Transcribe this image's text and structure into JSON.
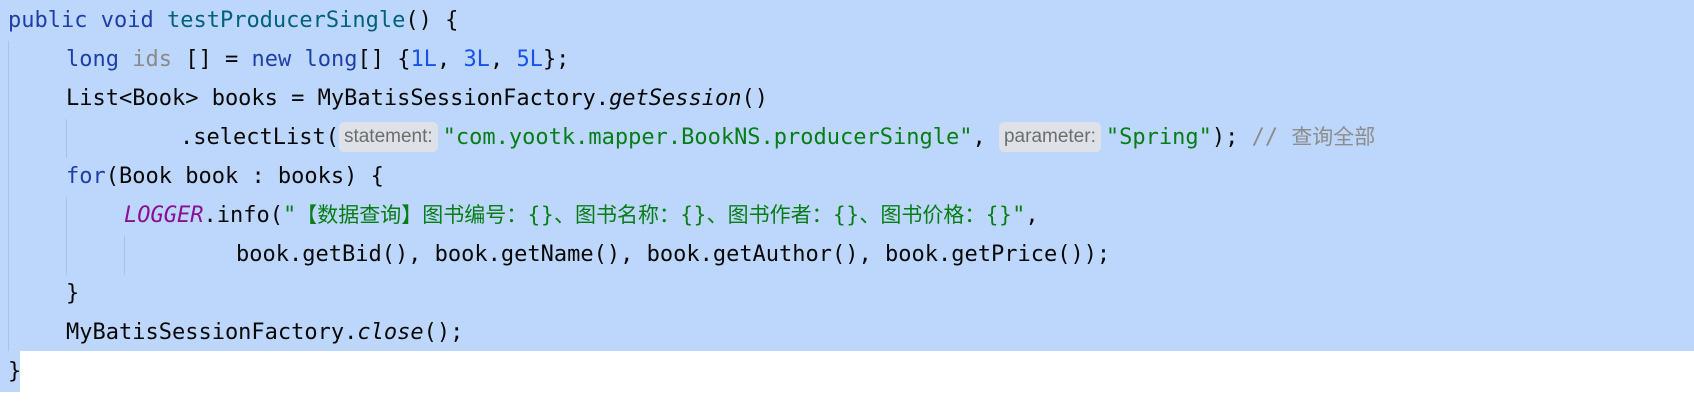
{
  "code": {
    "line1": {
      "kw1": "public",
      "kw2": "void",
      "method": "testProducerSingle",
      "rest": "() {"
    },
    "line2": {
      "kw1": "long",
      "var": "ids",
      "mid": " [] = ",
      "kw2": "new",
      "kw3": " long",
      "open": "[] {",
      "n1": "1L",
      "sep1": ", ",
      "n2": "3L",
      "sep2": ", ",
      "n3": "5L",
      "close": "};"
    },
    "line3": {
      "text1": "List<Book> books = MyBatisSessionFactory.",
      "call": "getSession",
      "text2": "()"
    },
    "line4": {
      "text1": ".selectList(",
      "hint1": "statement:",
      "str1": "\"com.yootk.mapper.BookNS.producerSingle\"",
      "sep": ", ",
      "hint2": "parameter:",
      "str2": "\"Spring\"",
      "text2": ");",
      "comment_slashes": " // ",
      "comment_text": "查询全部"
    },
    "line5": {
      "kw": "for",
      "text": "(Book book : books) {"
    },
    "line6": {
      "logger": "LOGGER",
      "text1": ".info(",
      "q1": "\"",
      "msg": "【数据查询】图书编号：{}、图书名称：{}、图书作者：{}、图书价格：{}",
      "q2": "\"",
      "text2": ","
    },
    "line7": {
      "text": "book.getBid(), book.getName(), book.getAuthor(), book.getPrice());"
    },
    "line8": {
      "text": "}"
    },
    "line9": {
      "text1": "MyBatisSessionFactory.",
      "call": "close",
      "text2": "();"
    },
    "line10": {
      "text": "}"
    }
  },
  "colors": {
    "selection": "#bcd7fb",
    "keyword": "#1f3fa6",
    "method_declaration": "#00627a",
    "number": "#1750eb",
    "string": "#067d17",
    "static_field": "#871094",
    "inlay_hint_background": "#dee2e8"
  }
}
